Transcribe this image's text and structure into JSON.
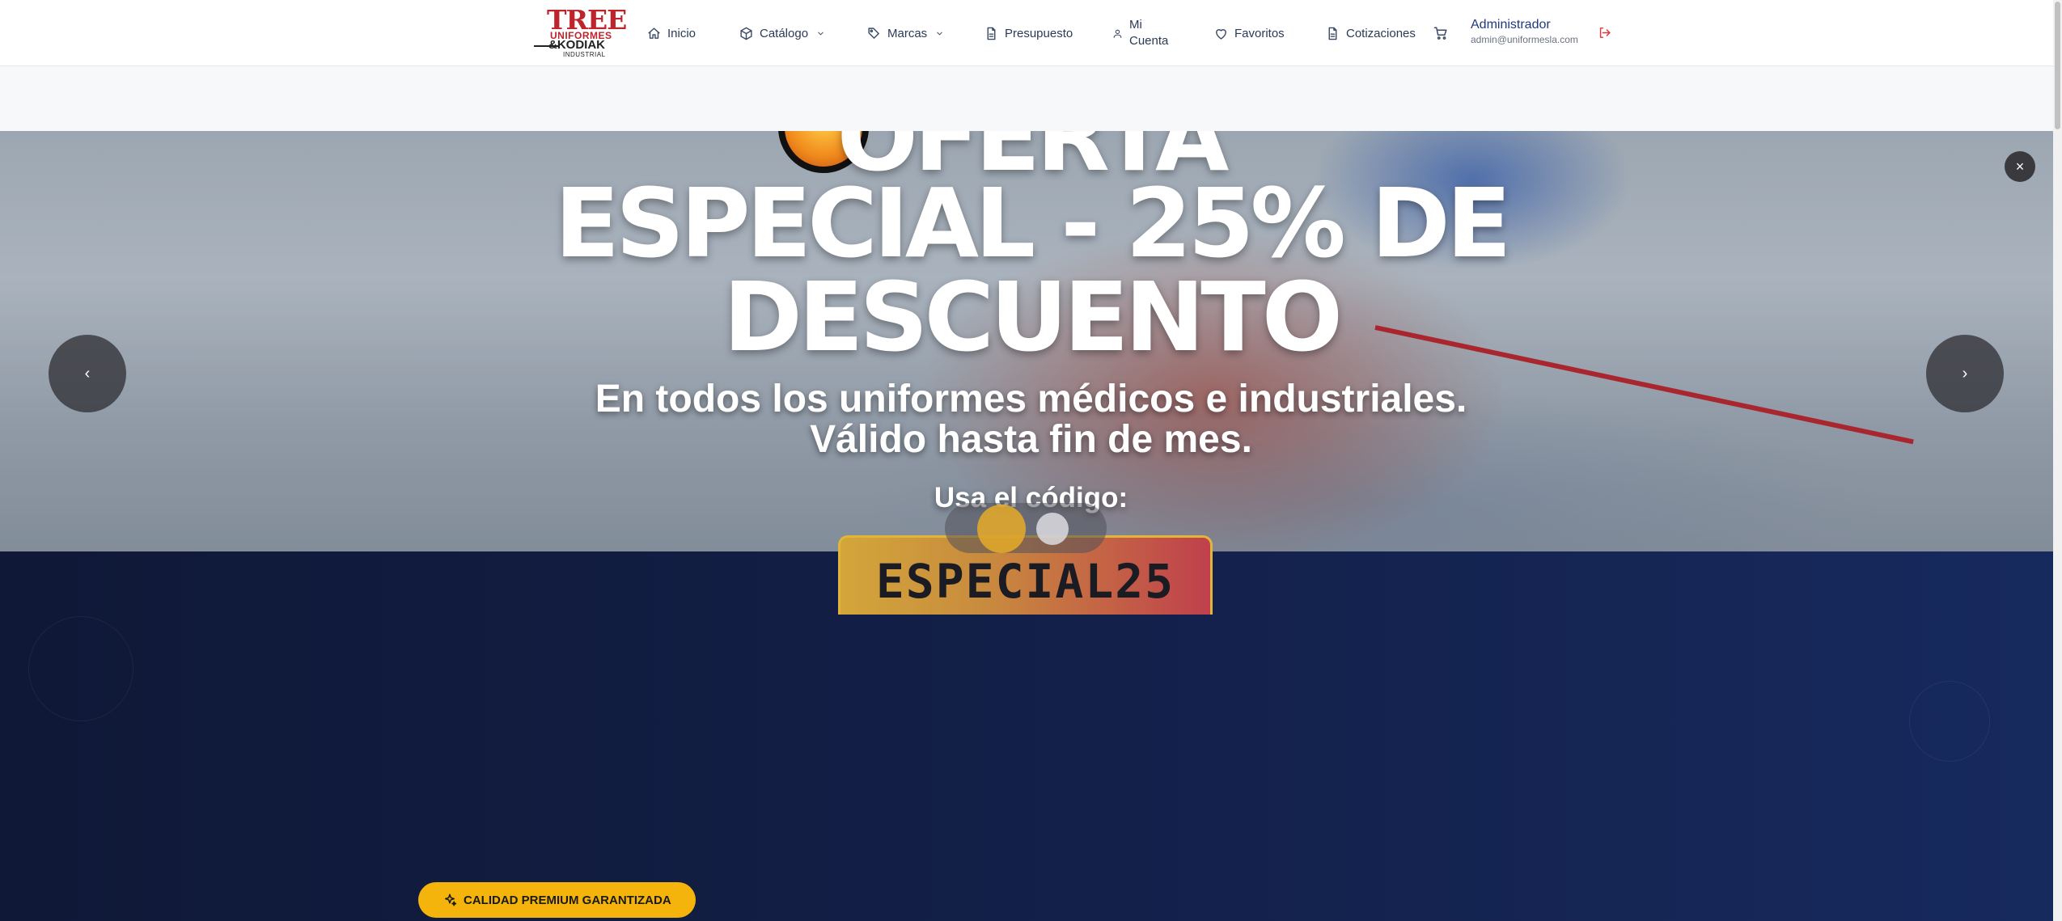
{
  "header": {
    "logo": {
      "line1": "TREE",
      "line2": "UNIFORMES",
      "line3": "&KODIAK",
      "line4": "INDUSTRIAL"
    },
    "nav": {
      "inicio": "Inicio",
      "catalogo": "Catálogo",
      "marcas": "Marcas",
      "presupuesto": "Presupuesto",
      "mi_cuenta_1": "Mi",
      "mi_cuenta_2": "Cuenta",
      "favoritos": "Favoritos",
      "cotizaciones": "Cotizaciones"
    },
    "user": {
      "name": "Administrador",
      "email": "admin@uniformesla.com"
    }
  },
  "hero": {
    "title_partial": "OFERTA",
    "title_line1": "ESPECIAL - 25% DE",
    "title_line2": "DESCUENTO",
    "subtitle_line1": "En todos los uniformes médicos e industriales.",
    "subtitle_line2": "Válido hasta fin de mes.",
    "code_label": "Usa el código:",
    "code": "ESPECIAL25",
    "prev": "‹",
    "next": "›",
    "close": "×"
  },
  "quality_badge": {
    "label": "CALIDAD PREMIUM GARANTIZADA"
  },
  "colors": {
    "brand_red": "#c0242b",
    "accent_yellow": "#f5b40c",
    "dark_bg": "#13204a"
  }
}
